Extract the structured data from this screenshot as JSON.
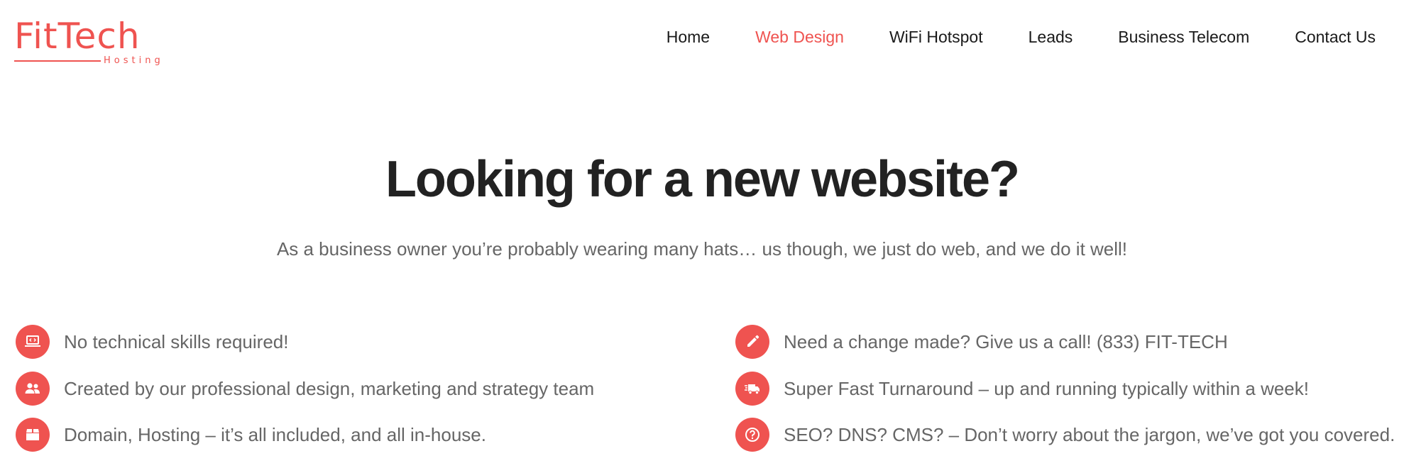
{
  "brand": {
    "name": "FitTech",
    "tagline": "Hosting",
    "color": "#ef5350"
  },
  "nav": {
    "items": [
      {
        "label": "Home"
      },
      {
        "label": "Web Design",
        "active": true
      },
      {
        "label": "WiFi Hotspot"
      },
      {
        "label": "Leads"
      },
      {
        "label": "Business Telecom"
      },
      {
        "label": "Contact Us"
      }
    ]
  },
  "hero": {
    "title": "Looking for a new website?",
    "subtitle": "As a business owner you’re probably wearing many hats… us though, we just do web, and we do it well!"
  },
  "features": {
    "left": [
      {
        "icon": "laptop-code-icon",
        "text": "No technical skills required!"
      },
      {
        "icon": "users-icon",
        "text": "Created by our professional design, marketing and strategy team"
      },
      {
        "icon": "box-icon",
        "text": "Domain, Hosting – it’s all included, and all in-house."
      }
    ],
    "right": [
      {
        "icon": "pencil-icon",
        "text": "Need a change made? Give us a call! (833) FIT-TECH"
      },
      {
        "icon": "shipping-fast-icon",
        "text": "Super Fast Turnaround –  up and running typically within a week!"
      },
      {
        "icon": "question-circle-icon",
        "text": "SEO? DNS? CMS? – Don’t worry about the jargon, we’ve got you covered."
      }
    ]
  }
}
